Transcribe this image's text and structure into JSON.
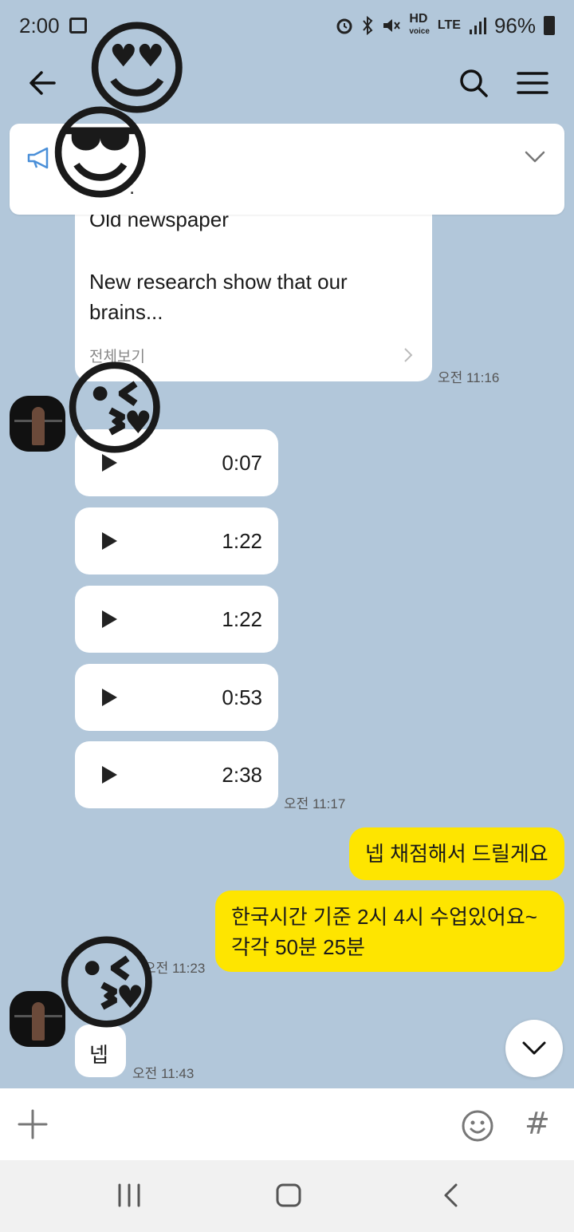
{
  "status_bar": {
    "time": "2:00",
    "hd": "HD",
    "voice": "voice",
    "lte": "LTE",
    "battery": "96%"
  },
  "notice": {
    "title": "."
  },
  "card": {
    "line1": "Old newspaper",
    "body": "New research show that our brains...",
    "more": "전체보기",
    "time": "오전 11:16"
  },
  "voice_messages": [
    {
      "duration": "0:07"
    },
    {
      "duration": "1:22"
    },
    {
      "duration": "1:22"
    },
    {
      "duration": "0:53"
    },
    {
      "duration": "2:38"
    }
  ],
  "voice_time": "오전 11:17",
  "my_messages": [
    {
      "text": "넵 채점해서 드릴게요"
    },
    {
      "text_line1": "한국시간 기준 2시 4시 수업있어요~",
      "text_line2": "각각 50분 25분"
    }
  ],
  "my_time": "오전 11:23",
  "other_reply": {
    "text": "넵",
    "time": "오전 11:43"
  },
  "emojis": {
    "heart_eyes": "😍",
    "sunglasses": "😎",
    "kiss": "😘"
  },
  "input": {
    "hash": "#"
  },
  "colors": {
    "chat_background": "#b2c7da",
    "my_bubble": "#fee500",
    "other_bubble": "#ffffff"
  }
}
